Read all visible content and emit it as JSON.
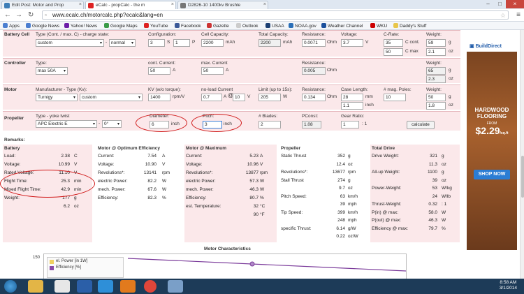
{
  "browser": {
    "tabs": [
      {
        "label": "Edit Post: Motor and Prop",
        "active": false
      },
      {
        "label": "eCalc - propCalc - the m",
        "active": true
      },
      {
        "label": "D2826-10 1400kv Brushle",
        "active": false
      }
    ],
    "url": "www.ecalc.ch/motorcalc.php?ecalc&lang=en",
    "bookmarks": [
      "Apps",
      "Google News",
      "Yahoo! News",
      "Google Maps",
      "YouTube",
      "Facebook",
      "Gazette",
      "Outlook",
      "USAA",
      "NOAA.gov",
      "Weather Channel",
      "WKU",
      "Daddy's Stuff"
    ]
  },
  "form": {
    "battery": {
      "section": "Battery Cell",
      "type_label": "Type (Cont. / max. C) - charge state:",
      "type_value": "custom",
      "charge_state": "normal",
      "config_label": "Configuration:",
      "config_s": "3",
      "s": "S",
      "config_p": "1",
      "p": "P",
      "capacity_label": "Cell Capacity:",
      "capacity": "2200",
      "capacity_unit": "mAh",
      "total_capacity_label": "Total Capacity:",
      "total_capacity": "2200",
      "total_capacity_unit": "mAh",
      "resistance_label": "Resistance:",
      "resistance": "0.0071",
      "resistance_unit": "Ohm",
      "voltage_label": "Voltage:",
      "voltage": "3.7",
      "voltage_unit": "V",
      "crate_label": "C-Rate:",
      "c_cont": "35",
      "c_cont_label": "C cont.",
      "c_max": "50",
      "c_max_label": "C max",
      "weight_label": "Weight:",
      "weight_g": "59",
      "weight_g_unit": "g",
      "weight_oz": "2.1",
      "weight_oz_unit": "oz"
    },
    "controller": {
      "section": "Controller",
      "type_label": "Type:",
      "type_value": "max 50A",
      "cont_label": "cont. Current:",
      "cont": "50",
      "cont_unit": "A",
      "max_label": "max. Current",
      "max": "50",
      "max_unit": "A",
      "resistance_label": "Resistance:",
      "resistance": "0.005",
      "resistance_unit": "Ohm",
      "weight_label": "Weight:",
      "weight_g": "65",
      "weight_g_unit": "g",
      "weight_oz": "2.3",
      "weight_oz_unit": "oz"
    },
    "motor": {
      "section": "Motor",
      "mfr_label": "Manufacturer - Type (Kv):",
      "mfr": "Turnigy",
      "type": "custom",
      "kv_label": "KV (w/o torque):",
      "kv": "1400",
      "kv_unit": "rpm/V",
      "noload_label": "no-load Current",
      "noload": "0.7",
      "noload_unit": "A",
      "at": "@",
      "noload_v": "10",
      "noload_v_unit": "V",
      "limit_label": "Limit (up to 15s):",
      "limit": "205",
      "limit_unit": "W",
      "resistance_label": "Resistance:",
      "resistance": "0.134",
      "resistance_unit": "Ohm",
      "case_label": "Case Length:",
      "case": "28",
      "case_unit": "mm",
      "case_in": "1.1",
      "case_in_unit": "inch",
      "poles_label": "# mag. Poles:",
      "poles": "10",
      "weight_label": "Weight:",
      "weight_g": "50",
      "weight_g_unit": "g",
      "weight_oz": "1.8",
      "weight_oz_unit": "oz"
    },
    "propeller": {
      "section": "Propeller",
      "type_label": "Type - yoke twist",
      "type_value": "APC Electric E",
      "twist": "0°",
      "diameter_label": "Diameter:",
      "diameter": "6",
      "diameter_unit": "inch",
      "pitch_label": "Pitch:",
      "pitch": "3",
      "pitch_unit": "inch",
      "blades_label": "# Blades:",
      "blades": "2",
      "pconst_label": "PConst:",
      "pconst": "1.08",
      "gear_label": "Gear Ratio:",
      "gear": "1",
      "gear_unit": ": 1",
      "calculate": "calculate"
    }
  },
  "remarks": {
    "title": "Remarks:",
    "battery": {
      "title": "Battery",
      "rows": [
        {
          "l": "Load:",
          "v": "2.38",
          "u": "C"
        },
        {
          "l": "Voltage:",
          "v": "10.99",
          "u": "V"
        },
        {
          "l": "Rated Voltage:",
          "v": "11.10",
          "u": "V"
        },
        {
          "l": "Flight Time:",
          "v": "25.3",
          "u": "min"
        },
        {
          "l": "Mixed Flight Time:",
          "v": "42.9",
          "u": "min"
        },
        {
          "l": "Weight:",
          "v": "177",
          "u": "g"
        },
        {
          "l": "",
          "v": "6.2",
          "u": "oz"
        }
      ]
    },
    "motor_opt": {
      "title": "Motor @ Optimum Efficiency",
      "rows": [
        {
          "l": "Current:",
          "v": "7.54",
          "u": "A"
        },
        {
          "l": "Voltage:",
          "v": "10.90",
          "u": "V"
        },
        {
          "l": "Revolutions*:",
          "v": "13141",
          "u": "rpm"
        },
        {
          "l": "electric Power:",
          "v": "82.2",
          "u": "W"
        },
        {
          "l": "mech. Power:",
          "v": "67.6",
          "u": "W"
        },
        {
          "l": "Efficiency:",
          "v": "82.3",
          "u": "%"
        }
      ]
    },
    "motor_max": {
      "title": "Motor @ Maximum",
      "rows": [
        {
          "l": "Current:",
          "v": "5.23",
          "u": "A"
        },
        {
          "l": "Voltage:",
          "v": "10.96",
          "u": "V"
        },
        {
          "l": "Revolutions*:",
          "v": "13877",
          "u": "rpm"
        },
        {
          "l": "electric Power:",
          "v": "57.3",
          "u": "W"
        },
        {
          "l": "mech. Power:",
          "v": "46.3",
          "u": "W"
        },
        {
          "l": "Efficiency:",
          "v": "80.7",
          "u": "%"
        },
        {
          "l": "est. Temperature:",
          "v": "32",
          "u": "°C"
        },
        {
          "l": "",
          "v": "90",
          "u": "°F"
        }
      ]
    },
    "propeller": {
      "title": "Propeller",
      "rows": [
        {
          "l": "Static Thrust",
          "v": "352",
          "u": "g"
        },
        {
          "l": "",
          "v": "12.4",
          "u": "oz"
        },
        {
          "l": "Revolutions*:",
          "v": "13677",
          "u": "rpm"
        },
        {
          "l": "Stall Thrust",
          "v": "274",
          "u": "g"
        },
        {
          "l": "",
          "v": "9.7",
          "u": "oz"
        },
        {
          "l": "Pitch Speed:",
          "v": "63",
          "u": "km/h"
        },
        {
          "l": "",
          "v": "39",
          "u": "mph"
        },
        {
          "l": "Tip Speed:",
          "v": "399",
          "u": "km/h"
        },
        {
          "l": "",
          "v": "248",
          "u": "mph"
        },
        {
          "l": "specific Thrust:",
          "v": "6.14",
          "u": "g/W"
        },
        {
          "l": "",
          "v": "0.22",
          "u": "oz/W"
        }
      ]
    },
    "total": {
      "title": "Total Drive",
      "rows": [
        {
          "l": "Drive Weight:",
          "v": "321",
          "u": "g"
        },
        {
          "l": "",
          "v": "11.3",
          "u": "oz"
        },
        {
          "l": "All-up Weight:",
          "v": "1100",
          "u": "g"
        },
        {
          "l": "",
          "v": "39",
          "u": "oz"
        },
        {
          "l": "Power-Weight:",
          "v": "53",
          "u": "W/kg"
        },
        {
          "l": "",
          "v": "24",
          "u": "W/lb"
        },
        {
          "l": "Thrust-Weight:",
          "v": "0.32",
          "u": ": 1"
        },
        {
          "l": "P(in) @ max:",
          "v": "58.0",
          "u": "W"
        },
        {
          "l": "P(out) @ max:",
          "v": "46.3",
          "u": "W"
        },
        {
          "l": "Efficiency @ max:",
          "v": "79.7",
          "u": "%"
        }
      ]
    }
  },
  "chart": {
    "title": "Motor Characteristics",
    "y_tick": "150",
    "legend": [
      "el. Power [in 1W]",
      "Efficiency [%]"
    ]
  },
  "ad": {
    "brand": "BuildDirect",
    "line1": "HARDWOOD",
    "line2": "FLOORING",
    "from": "FROM",
    "price": "$2.29",
    "price_unit": "/sq.ft",
    "cta": "SHOP NOW"
  },
  "taskbar": {
    "time": "8:58 AM",
    "date": "3/1/2014"
  },
  "colors": {
    "section_bg": "#fbe8ea",
    "highlight": "#d01818"
  }
}
